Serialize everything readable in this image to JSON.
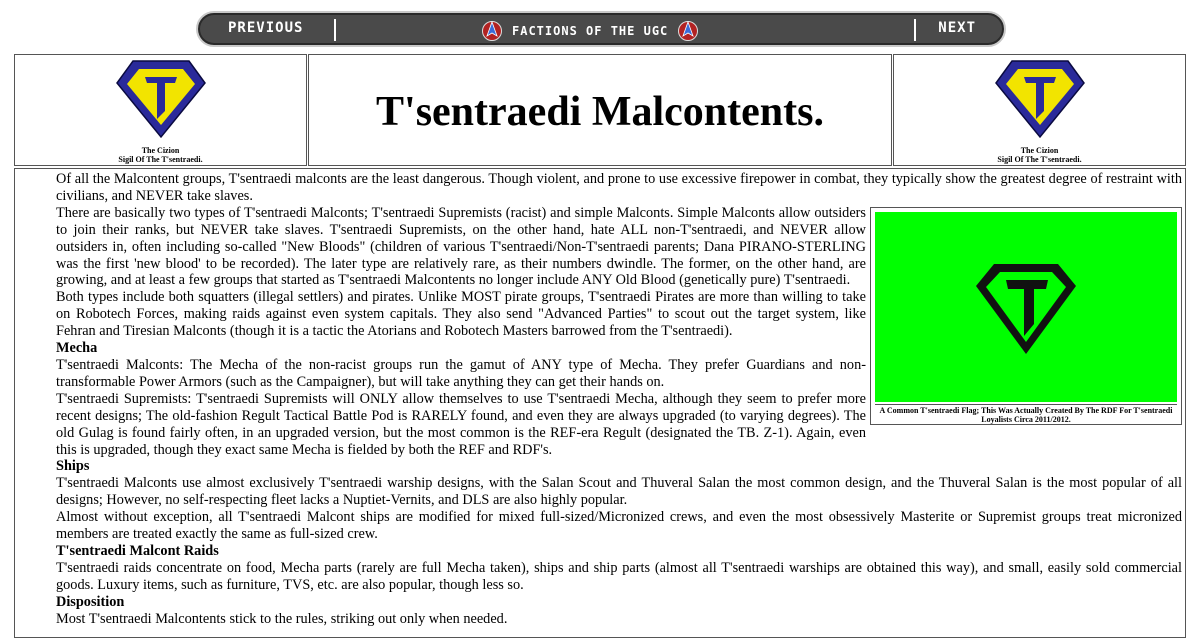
{
  "nav": {
    "previous": "PREVIOUS",
    "title": "FACTIONS OF THE UGC",
    "next": "NEXT"
  },
  "header": {
    "title": "T'sentraedi Malcontents.",
    "sigil_caption_line1": "The Cizion",
    "sigil_caption_line2": "Sigil Of The T'sentraedi."
  },
  "flag": {
    "caption": "A Common T'sentraedi Flag; This Was Actually Created By The RDF For T'sentraedi Loyalists Circa 2011/2012.",
    "color": "#00ff00"
  },
  "body": {
    "p1": "Of all the Malcontent groups, T'sentraedi malconts are the least dangerous. Though violent, and prone to use excessive firepower in combat, they typically show the greatest degree of restraint with civilians, and NEVER take slaves.",
    "p2": "There are basically two types of T'sentraedi Malconts; T'sentraedi Supremists (racist) and simple Malconts. Simple Malconts allow outsiders to join their ranks, but NEVER take slaves. T'sentraedi Supremists, on the other hand, hate ALL non-T'sentraedi, and NEVER allow outsiders in, often including so-called \"New Bloods\" (children of various T'sentraedi/Non-T'sentraedi parents; Dana PIRANO-STERLING was the first 'new blood' to be recorded). The later type are relatively rare, as their numbers dwindle. The former, on the other hand, are growing, and at least a few groups that started as T'sentraedi Malcontents no longer include ANY Old Blood (genetically pure) T'sentraedi.",
    "p3": "Both types include both squatters (illegal settlers) and pirates. Unlike MOST pirate groups, T'sentraedi Pirates are more than willing to take on Robotech Forces, making raids against even system capitals. They also send \"Advanced Parties\" to scout out the target system, like Fehran and Tiresian Malconts (though it is a tactic the Atorians and Robotech Masters barrowed from the T'sentraedi).",
    "h_mecha": "Mecha",
    "p4": "T'sentraedi Malconts: The Mecha of the non-racist groups run the gamut of ANY type of Mecha. They prefer Guardians and non-transformable Power Armors (such as the Campaigner), but will take anything they can get their hands on.",
    "p5": "T'sentraedi Supremists: T'sentraedi Supremists will ONLY allow themselves to use T'sentraedi Mecha, although they seem to prefer more recent designs; The old-fashion Regult Tactical Battle Pod is RARELY found, and even they are always upgraded (to varying degrees). The old Gulag is found fairly often, in an upgraded version, but the most common is the REF-era Regult (designated the TB. Z-1). Again, even this is upgraded, though they exact same Mecha is fielded by both the REF and RDF's.",
    "h_ships": "Ships",
    "p6": "T'sentraedi Malconts use almost exclusively T'sentraedi warship designs, with the Salan Scout and Thuveral Salan the most common design, and the Thuveral Salan is the most popular of all designs; However, no self-respecting fleet lacks a Nuptiet-Vernits, and DLS are also highly popular.",
    "p7": "Almost without exception, all T'sentraedi Malcont ships are modified for mixed full-sized/Micronized crews, and even the most obsessively Masterite or Supremist groups treat micronized members are treated exactly the same as full-sized crew.",
    "h_raids": "T'sentraedi Malcont Raids",
    "p8": "T'sentraedi raids concentrate on food, Mecha parts (rarely are full Mecha taken), ships and ship parts (almost all T'sentraedi warships are obtained this way), and small, easily sold commercial goods. Luxury items, such as furniture, TVS, etc. are also popular, though less so.",
    "h_disposition": "Disposition",
    "p9": "Most T'sentraedi Malcontents stick to the rules, striking out only when needed."
  }
}
